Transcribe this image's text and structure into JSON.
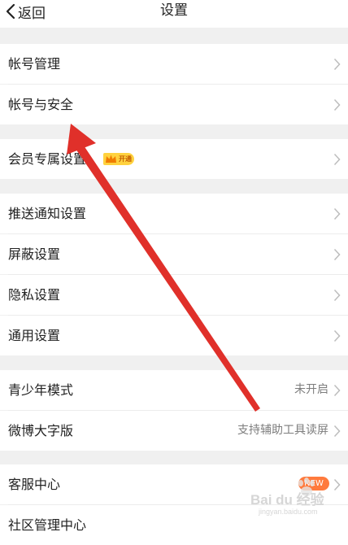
{
  "header": {
    "back_label": "返回",
    "title": "设置"
  },
  "rows": {
    "account_management": {
      "label": "帐号管理"
    },
    "account_security": {
      "label": "帐号与安全"
    },
    "vip_settings": {
      "label": "会员专属设置",
      "badge": "开通"
    },
    "push_notifications": {
      "label": "推送通知设置"
    },
    "block_settings": {
      "label": "屏蔽设置"
    },
    "privacy_settings": {
      "label": "隐私设置"
    },
    "general_settings": {
      "label": "通用设置"
    },
    "youth_mode": {
      "label": "青少年模式",
      "value": "未开启"
    },
    "large_font": {
      "label": "微博大字版",
      "value": "支持辅助工具读屏"
    },
    "customer_service": {
      "label": "客服中心",
      "badge": "NEW"
    },
    "community_management": {
      "label": "社区管理中心"
    }
  },
  "watermark": {
    "text": "Bai du 经验",
    "sub": "jingyan.baidu.com"
  },
  "colors": {
    "background": "#f0f0f0",
    "row": "#ffffff",
    "annotation_arrow": "#e0302a",
    "vip_badge": "#ffd23f",
    "new_badge": "#ff7a3d"
  },
  "icons": {
    "back": "chevron-left-icon",
    "row_chevron": "chevron-right-icon",
    "vip": "crown-icon",
    "annotation": "red-arrow-annotation"
  }
}
